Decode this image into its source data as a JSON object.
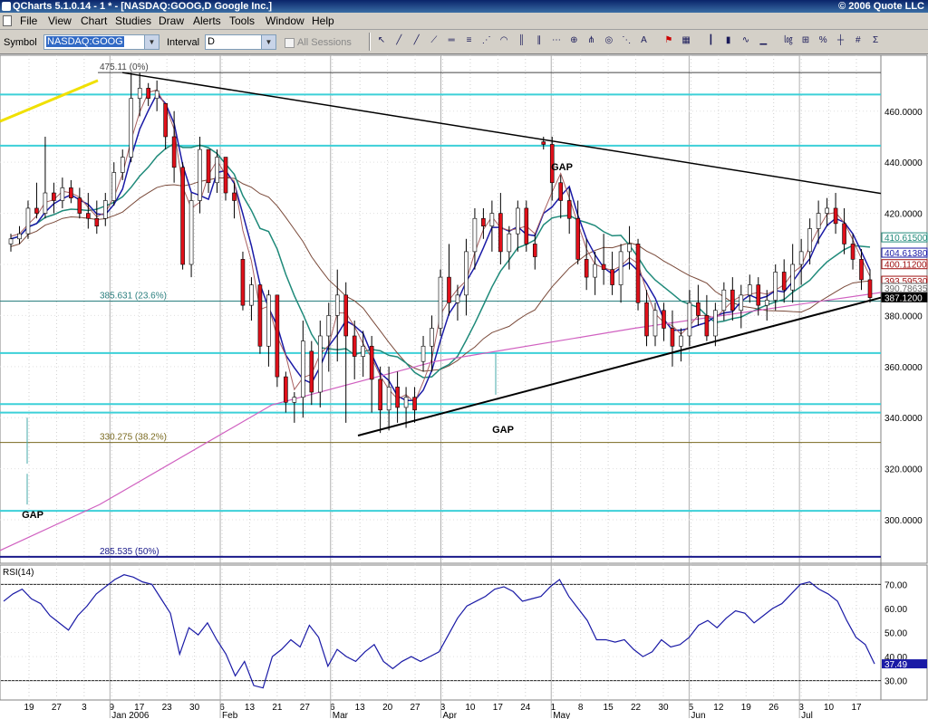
{
  "window": {
    "title": "QCharts 5.1.0.14 - 1 * - [NASDAQ:GOOG,D Google Inc.]",
    "copyright": "© 2006 Quote LLC"
  },
  "menu": [
    "File",
    "View",
    "Chart",
    "Studies",
    "Draw",
    "Alerts",
    "Tools",
    "Window",
    "Help"
  ],
  "toolbar": {
    "symbol_label": "Symbol",
    "symbol_value": "NASDAQ:GOOG",
    "interval_label": "Interval",
    "interval_value": "D",
    "all_sessions_label": "All Sessions",
    "tool_icons": [
      "pointer-icon",
      "line-icon",
      "ray-icon",
      "extended-line-icon",
      "horizontal-line-icon",
      "fib-retracement-icon",
      "fib-fan-icon",
      "fib-arc-icon",
      "fib-time-icon",
      "channel-icon",
      "regression-icon",
      "gann-icon",
      "andrews-fork-icon",
      "cycle-icon",
      "speed-line-icon",
      "text-icon",
      "alert-icon",
      "snapshot-icon",
      "bar-style-icon",
      "candle-style-icon",
      "line-style-icon",
      "volume-icon",
      "log-scale-icon",
      "zoom-icon",
      "percent-icon",
      "crosshair-icon",
      "grid-icon",
      "studies-icon"
    ]
  },
  "chart_data": {
    "type": "candlestick",
    "symbol": "NASDAQ:GOOG",
    "price_axis": {
      "ylim": [
        283,
        478
      ],
      "ticks": [
        "460.0000",
        "440.0000",
        "420.0000",
        "400.0000",
        "380.0000",
        "360.0000",
        "340.0000",
        "320.0000",
        "300.0000"
      ]
    },
    "date_axis": {
      "ticks": [
        "19",
        "27",
        "3",
        "9",
        "17",
        "23",
        "30",
        "6",
        "13",
        "21",
        "27",
        "6",
        "13",
        "20",
        "27",
        "3",
        "10",
        "17",
        "24",
        "1",
        "8",
        "15",
        "22",
        "30",
        "5",
        "12",
        "19",
        "26",
        "3",
        "10",
        "17"
      ],
      "months": [
        "Jan 2006",
        "Feb",
        "Mar",
        "Apr",
        "May",
        "Jun",
        "Jul"
      ]
    },
    "price_labels": [
      {
        "text": "410.61500",
        "color": "#1f8a7a"
      },
      {
        "text": "404.61380",
        "color": "#1a1aa6"
      },
      {
        "text": "400.11200",
        "color": "#a01010"
      },
      {
        "text": "393.59530",
        "color": "#a01010"
      },
      {
        "text": "390.78635",
        "color": "#6a6a6a"
      },
      {
        "text": "387.1200",
        "color": "#000000"
      }
    ],
    "fib_levels": [
      {
        "text": "475.11 (0%)",
        "value": 475.11
      },
      {
        "text": "385.631 (23.6%)",
        "value": 385.631
      },
      {
        "text": "330.275 (38.2%)",
        "value": 330.275
      },
      {
        "text": "285.535 (50%)",
        "value": 285.535
      }
    ],
    "horizontal_levels": [
      466.5,
      446.5,
      365.3,
      345.3,
      342.0,
      303.5
    ],
    "annotations": [
      "GAP",
      "GAP",
      "GAP"
    ],
    "trendlines": {
      "upper": [
        [
          3,
          475.1
        ],
        [
          93,
          427.8
        ]
      ],
      "lower": [
        [
          38,
          333
        ],
        [
          93,
          387
        ]
      ]
    },
    "candles": [
      [
        408,
        412,
        405,
        410
      ],
      [
        410,
        415,
        408,
        412
      ],
      [
        412,
        425,
        410,
        422
      ],
      [
        422,
        432,
        418,
        420
      ],
      [
        420,
        450,
        418,
        428
      ],
      [
        428,
        432,
        420,
        425
      ],
      [
        425,
        434,
        422,
        430
      ],
      [
        430,
        433,
        424,
        426
      ],
      [
        426,
        430,
        418,
        420
      ],
      [
        420,
        428,
        414,
        418
      ],
      [
        418,
        425,
        412,
        415
      ],
      [
        418,
        428,
        415,
        425
      ],
      [
        425,
        440,
        423,
        436
      ],
      [
        436,
        445,
        433,
        442
      ],
      [
        442,
        475,
        440,
        465
      ],
      [
        465,
        475,
        458,
        469
      ],
      [
        469,
        471,
        462,
        465
      ],
      [
        465,
        472,
        460,
        468
      ],
      [
        463,
        462,
        445,
        450
      ],
      [
        450,
        460,
        432,
        438
      ],
      [
        438,
        440,
        398,
        400
      ],
      [
        400,
        428,
        395,
        425
      ],
      [
        425,
        450,
        420,
        445
      ],
      [
        445,
        440,
        428,
        432
      ],
      [
        432,
        445,
        428,
        442
      ],
      [
        442,
        438,
        425,
        428
      ],
      [
        428,
        432,
        418,
        425
      ],
      [
        402,
        405,
        382,
        384
      ],
      [
        384,
        395,
        378,
        392
      ],
      [
        392,
        390,
        365,
        368
      ],
      [
        368,
        390,
        360,
        388
      ],
      [
        388,
        385,
        352,
        356
      ],
      [
        356,
        358,
        342,
        346
      ],
      [
        346,
        350,
        338,
        348
      ],
      [
        348,
        378,
        340,
        370
      ],
      [
        366,
        370,
        345,
        350
      ],
      [
        350,
        378,
        344,
        372
      ],
      [
        372,
        385,
        358,
        380
      ],
      [
        380,
        398,
        362,
        388
      ],
      [
        388,
        393,
        338,
        372
      ],
      [
        372,
        378,
        355,
        364
      ],
      [
        364,
        374,
        356,
        368
      ],
      [
        368,
        372,
        342,
        355
      ],
      [
        355,
        360,
        334,
        343
      ],
      [
        343,
        360,
        335,
        352
      ],
      [
        352,
        358,
        338,
        344
      ],
      [
        344,
        352,
        336,
        348
      ],
      [
        348,
        352,
        338,
        343
      ],
      [
        362,
        372,
        358,
        368
      ],
      [
        368,
        380,
        358,
        375
      ],
      [
        375,
        398,
        372,
        395
      ],
      [
        395,
        408,
        380,
        385
      ],
      [
        385,
        392,
        378,
        388
      ],
      [
        388,
        410,
        380,
        405
      ],
      [
        405,
        422,
        398,
        418
      ],
      [
        418,
        422,
        410,
        415
      ],
      [
        415,
        425,
        405,
        420
      ],
      [
        420,
        428,
        400,
        405
      ],
      [
        405,
        415,
        398,
        412
      ],
      [
        412,
        425,
        405,
        422
      ],
      [
        422,
        425,
        405,
        408
      ],
      [
        408,
        412,
        398,
        403
      ],
      [
        448,
        450,
        445,
        447
      ],
      [
        447,
        450,
        425,
        432
      ],
      [
        432,
        435,
        418,
        425
      ],
      [
        425,
        430,
        412,
        418
      ],
      [
        418,
        425,
        400,
        402
      ],
      [
        402,
        410,
        390,
        395
      ],
      [
        395,
        405,
        388,
        400
      ],
      [
        400,
        412,
        392,
        398
      ],
      [
        398,
        405,
        388,
        392
      ],
      [
        392,
        408,
        385,
        405
      ],
      [
        405,
        415,
        398,
        408
      ],
      [
        408,
        410,
        382,
        385
      ],
      [
        385,
        390,
        368,
        372
      ],
      [
        372,
        385,
        368,
        382
      ],
      [
        382,
        385,
        370,
        375
      ],
      [
        375,
        382,
        360,
        368
      ],
      [
        368,
        375,
        362,
        372
      ],
      [
        372,
        390,
        368,
        385
      ],
      [
        385,
        392,
        376,
        380
      ],
      [
        380,
        388,
        370,
        372
      ],
      [
        372,
        385,
        368,
        382
      ],
      [
        382,
        393,
        378,
        390
      ],
      [
        390,
        395,
        378,
        382
      ],
      [
        382,
        392,
        375,
        388
      ],
      [
        388,
        396,
        385,
        392
      ],
      [
        392,
        395,
        380,
        384
      ],
      [
        384,
        390,
        378,
        386
      ],
      [
        386,
        400,
        382,
        397
      ],
      [
        397,
        402,
        385,
        390
      ],
      [
        390,
        408,
        385,
        400
      ],
      [
        400,
        410,
        392,
        405
      ],
      [
        405,
        418,
        400,
        414
      ],
      [
        414,
        425,
        408,
        420
      ],
      [
        420,
        426,
        415,
        422
      ],
      [
        422,
        428,
        412,
        416
      ],
      [
        416,
        422,
        404,
        408
      ],
      [
        408,
        412,
        398,
        402
      ],
      [
        402,
        406,
        390,
        394
      ],
      [
        394,
        398,
        385,
        387
      ]
    ],
    "rsi": {
      "label": "RSI(14)",
      "ylim": [
        25,
        75
      ],
      "ticks": [
        "70.00",
        "60.00",
        "50.00",
        "40.00",
        "30.00"
      ],
      "last_label": "37.49",
      "values": [
        63,
        66,
        68,
        64,
        62,
        57,
        54,
        51,
        57,
        61,
        66,
        69,
        72,
        74,
        73,
        71,
        70,
        64,
        58,
        41,
        52,
        49,
        54,
        47,
        41,
        32,
        38,
        28,
        27,
        40,
        43,
        47,
        44,
        53,
        48,
        36,
        43,
        40,
        38,
        42,
        45,
        38,
        35,
        38,
        40,
        38,
        40,
        42,
        49,
        56,
        61,
        63,
        65,
        68,
        69,
        67,
        63,
        64,
        65,
        69,
        72,
        65,
        60,
        55,
        47,
        47,
        46,
        47,
        43,
        40,
        42,
        47,
        44,
        45,
        48,
        53,
        55,
        52,
        56,
        59,
        58,
        54,
        57,
        60,
        62,
        66,
        70,
        71,
        68,
        66,
        63,
        55,
        48,
        45,
        37
      ]
    }
  }
}
